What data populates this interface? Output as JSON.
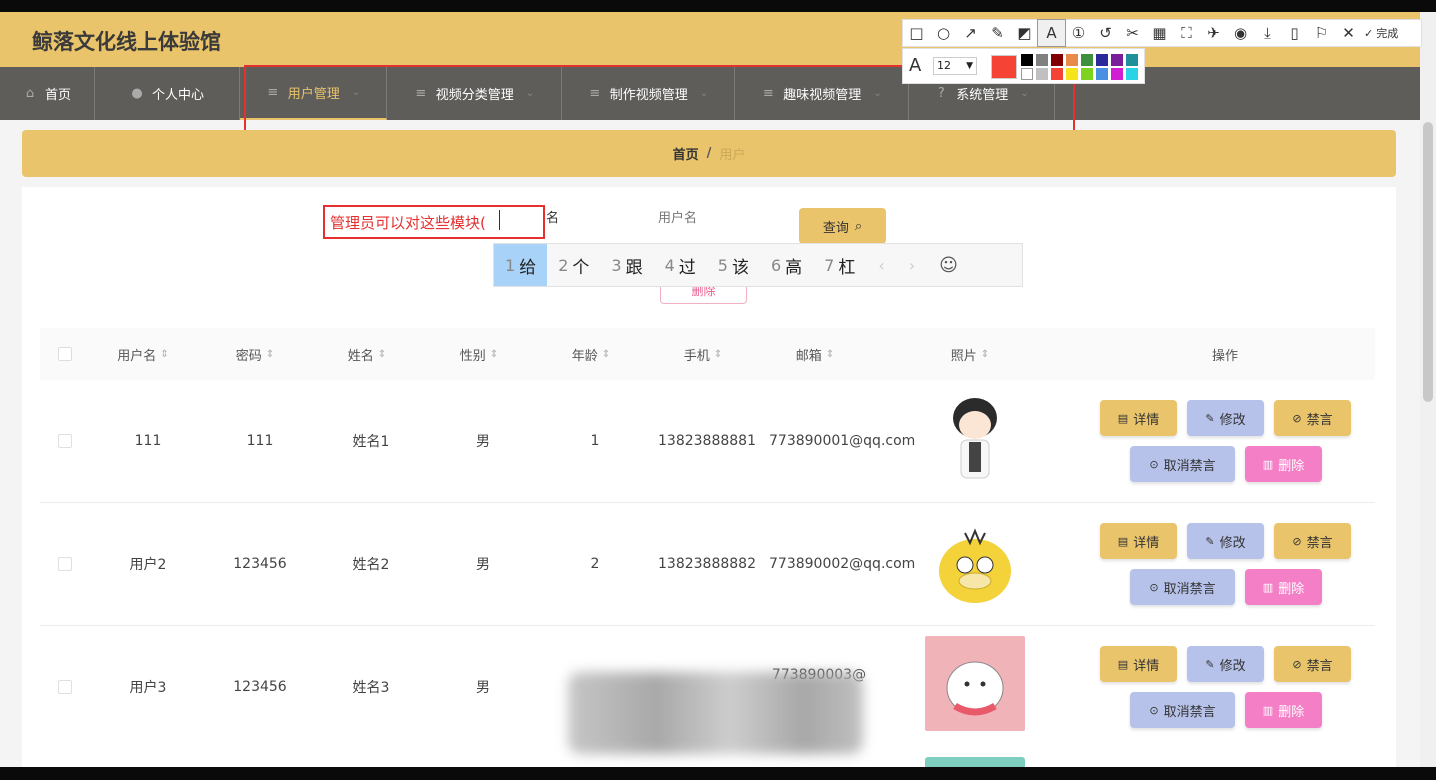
{
  "header": {
    "title": "鲸落文化线上体验馆"
  },
  "nav": [
    {
      "label": "首页",
      "icon": "home-icon"
    },
    {
      "label": "个人中心",
      "icon": "user-icon"
    },
    {
      "label": "用户管理",
      "icon": "menu-icon"
    },
    {
      "label": "视频分类管理",
      "icon": "menu-icon"
    },
    {
      "label": "制作视频管理",
      "icon": "menu-icon"
    },
    {
      "label": "趣味视频管理",
      "icon": "menu-icon"
    },
    {
      "label": "系统管理",
      "icon": "question-icon"
    }
  ],
  "breadcrumb": {
    "home": "首页",
    "sep": "/",
    "current": "用户"
  },
  "search": {
    "label": "用户名",
    "placeholder": "用户名",
    "query_label": "查询",
    "delete_label": "删除"
  },
  "annotation": {
    "text": "管理员可以对这些模块("
  },
  "ime": {
    "candidates": [
      {
        "num": "1",
        "word": "给"
      },
      {
        "num": "2",
        "word": "个"
      },
      {
        "num": "3",
        "word": "跟"
      },
      {
        "num": "4",
        "word": "过"
      },
      {
        "num": "5",
        "word": "该"
      },
      {
        "num": "6",
        "word": "高"
      },
      {
        "num": "7",
        "word": "杠"
      }
    ],
    "prev": "‹",
    "next": "›",
    "emoji": "☺"
  },
  "table": {
    "columns": [
      "用户名",
      "密码",
      "姓名",
      "性别",
      "年龄",
      "手机",
      "邮箱",
      "照片",
      "操作"
    ],
    "rows": [
      {
        "username": "111",
        "password": "111",
        "name": "姓名1",
        "gender": "男",
        "age": "1",
        "phone": "13823888881",
        "email": "773890001@qq.com"
      },
      {
        "username": "用户2",
        "password": "123456",
        "name": "姓名2",
        "gender": "男",
        "age": "2",
        "phone": "13823888882",
        "email": "773890002@qq.com"
      },
      {
        "username": "用户3",
        "password": "123456",
        "name": "姓名3",
        "gender": "男",
        "age": "",
        "phone": "",
        "email": "773890003@"
      }
    ],
    "actions": {
      "detail": "详情",
      "edit": "修改",
      "ban": "禁言",
      "unban": "取消禁言",
      "delete": "删除"
    }
  },
  "screenshot_tool": {
    "done_label": "完成",
    "font_size": "12",
    "current_color": "#f54336",
    "palette": [
      "#000000",
      "#808080",
      "#800000",
      "#e88a4a",
      "#3f8f3f",
      "#2a2a9a",
      "#7a1f9a",
      "#1f8f9a",
      "#ffffff",
      "#c0c0c0",
      "#f54336",
      "#f5e51a",
      "#7ed321",
      "#4a90e2",
      "#d01fd0",
      "#2ad4e6"
    ]
  },
  "colors": {
    "accent": "#eac46b",
    "nav_bg": "#5e5d5a",
    "danger": "#e53030",
    "edit": "#b6c2ea",
    "delete": "#f47fc6"
  }
}
